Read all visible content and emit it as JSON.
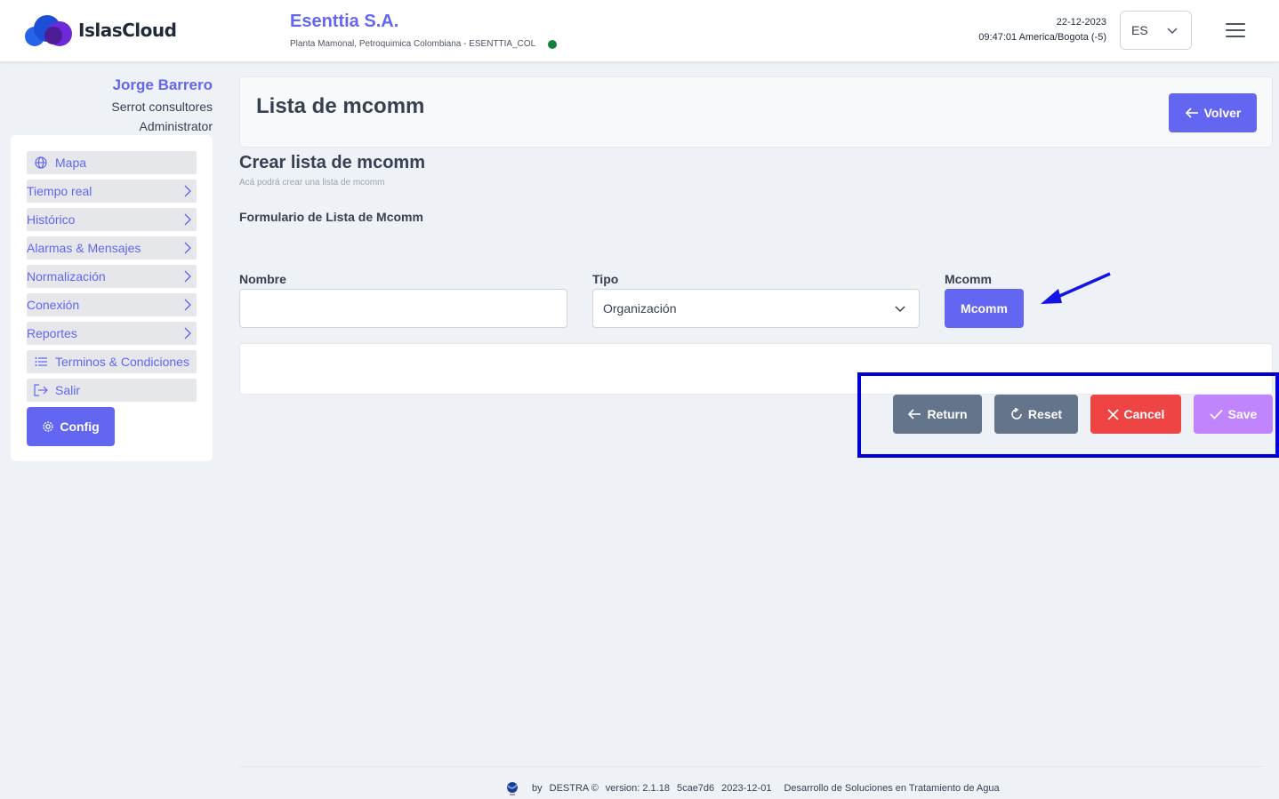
{
  "header": {
    "logo_text": "IslasCloud",
    "company_name": "Esenttia S.A.",
    "company_sub": "Planta Mamonal, Petroquimica Colombiana - ESENTTIA_COL",
    "date": "22-12-2023",
    "time": "09:47:01 America/Bogota (-5)",
    "language": "ES"
  },
  "user": {
    "name": "Jorge Barrero",
    "organization": "Serrot consultores",
    "role": "Administrator"
  },
  "sidebar": {
    "items": [
      {
        "label": "Mapa",
        "icon": "globe-icon"
      },
      {
        "label": "Tiempo real",
        "icon": "chevron-right-icon"
      },
      {
        "label": "Histórico",
        "icon": "chevron-right-icon"
      },
      {
        "label": "Alarmas & Mensajes",
        "icon": "chevron-right-icon"
      },
      {
        "label": "Normalización",
        "icon": "chevron-right-icon"
      },
      {
        "label": "Conexión",
        "icon": "chevron-right-icon"
      },
      {
        "label": "Reportes",
        "icon": "chevron-right-icon"
      },
      {
        "label": "Terminos & Condiciones",
        "icon": "list-icon"
      },
      {
        "label": "Salir",
        "icon": "logout-icon"
      }
    ],
    "config_label": "Config"
  },
  "page": {
    "title": "Lista de mcomm",
    "back_label": "Volver",
    "section_title": "Crear lista de mcomm",
    "section_subtitle": "Acá podrá crear una lista de mcomm",
    "form_title": "Formulario de Lista de Mcomm"
  },
  "form": {
    "nombre_label": "Nombre",
    "nombre_value": "",
    "tipo_label": "Tipo",
    "tipo_value": "Organización",
    "mcomm_label": "Mcomm",
    "mcomm_button": "Mcomm"
  },
  "actions": {
    "return_label": "Return",
    "reset_label": "Reset",
    "cancel_label": "Cancel",
    "save_label": "Save"
  },
  "footer": {
    "by": "by",
    "brand": "DESTRA ©",
    "version": "version: 2.1.18",
    "hash": "5cae7d6",
    "date": "2023-12-01",
    "tagline": "Desarrollo de Soluciones en Tratamiento de Agua"
  },
  "colors": {
    "accent": "#6366f1",
    "gray_button": "#64748b",
    "cancel": "#ef4444",
    "save": "#c084fc",
    "status": "#15803d",
    "highlight": "#0000d6"
  }
}
